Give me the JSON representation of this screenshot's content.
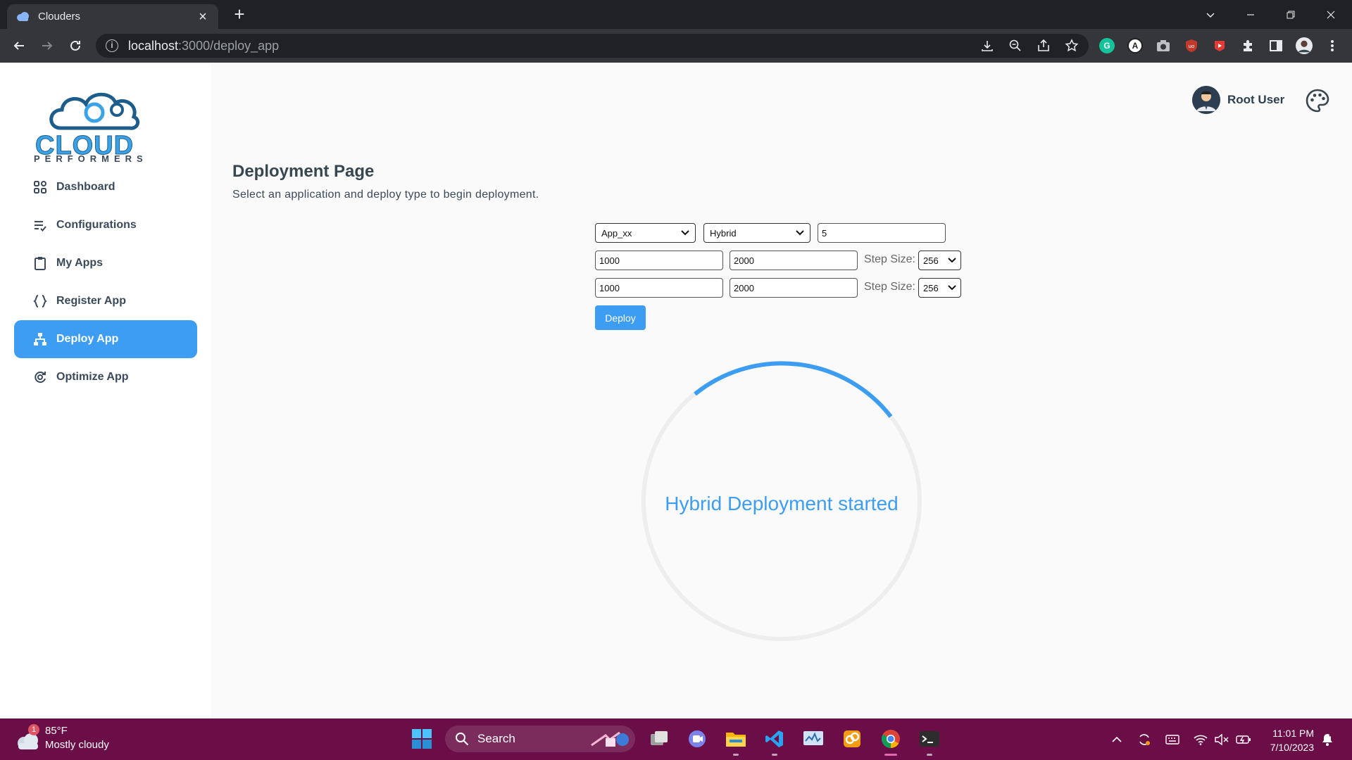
{
  "browser": {
    "tab_title": "Clouders",
    "tab_close": "×",
    "new_tab": "+",
    "url_host": "localhost",
    "url_path": ":3000/deploy_app"
  },
  "logo": {
    "main": "CLOUD",
    "sub": "PERFORMERS"
  },
  "sidebar": {
    "items": [
      {
        "label": "Dashboard",
        "icon": "dashboard-icon"
      },
      {
        "label": "Configurations",
        "icon": "configurations-icon"
      },
      {
        "label": "My Apps",
        "icon": "clipboard-icon"
      },
      {
        "label": "Register App",
        "icon": "braces-icon"
      },
      {
        "label": "Deploy App",
        "icon": "hierarchy-icon",
        "active": true
      },
      {
        "label": "Optimize App",
        "icon": "optimize-icon"
      }
    ]
  },
  "user": {
    "name": "Root User"
  },
  "page": {
    "title": "Deployment Page",
    "subtitle": "Select an application and deploy type to begin deployment."
  },
  "form": {
    "app_select": "App_xx",
    "type_select": "Hybrid",
    "count_input": "5",
    "row1_min": "1000",
    "row1_max": "2000",
    "row1_step_label": "Step Size:",
    "row1_step": "256",
    "row2_min": "1000",
    "row2_max": "2000",
    "row2_step_label": "Step Size:",
    "row2_step": "256",
    "deploy_label": "Deploy"
  },
  "status": {
    "message": "Hybrid Deployment started",
    "color": "#3d9df2"
  },
  "taskbar": {
    "weather_temp": "85°F",
    "weather_desc": "Mostly cloudy",
    "weather_badge": "1",
    "search_label": "Search",
    "time": "11:01 PM",
    "date": "7/10/2023"
  },
  "colors": {
    "accent": "#3d9df2",
    "taskbar": "#6b0d47",
    "chrome_dark": "#202124"
  }
}
